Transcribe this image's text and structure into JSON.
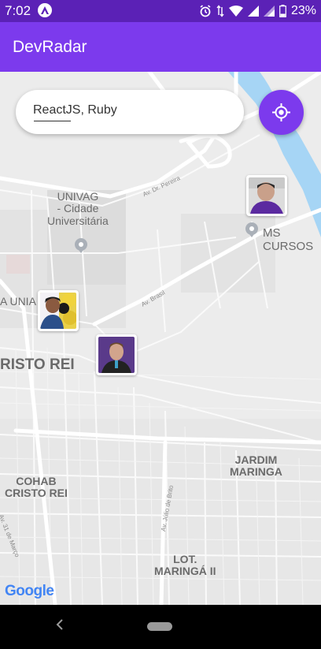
{
  "status_bar": {
    "time": "7:02",
    "battery": "23%",
    "icons": [
      "app-a-icon",
      "alarm-icon",
      "data-arrows-icon",
      "wifi-icon",
      "signal-icon",
      "signal-icon",
      "battery-icon"
    ]
  },
  "app_bar": {
    "title": "DevRadar"
  },
  "search": {
    "value": "ReactJS, Ruby"
  },
  "colors": {
    "primary": "#7c3aed",
    "status_bar": "#5b21b6"
  },
  "map": {
    "labels": {
      "univag": "UNIVAG\n- Cidade\nUniversitária",
      "ms_cursos": "MS CURSOS",
      "unia": "A UNIA",
      "cristo_rei": "RISTO REI",
      "jardim": "JARDIM\nMARINGA",
      "cohab": "COHAB\nCRISTO REI",
      "lot": "LOT.\nMARINGÁ II"
    },
    "roads": {
      "dr_pereira": "Av. Dr. Pereira",
      "brasil": "Av. Brasil",
      "marco": "Av. 31 de Março",
      "julio": "Av. Júlio de Brito"
    },
    "attribution": "Google"
  },
  "markers": [
    {
      "name": "developer-avatar-1"
    },
    {
      "name": "developer-avatar-2"
    },
    {
      "name": "developer-avatar-3"
    }
  ]
}
